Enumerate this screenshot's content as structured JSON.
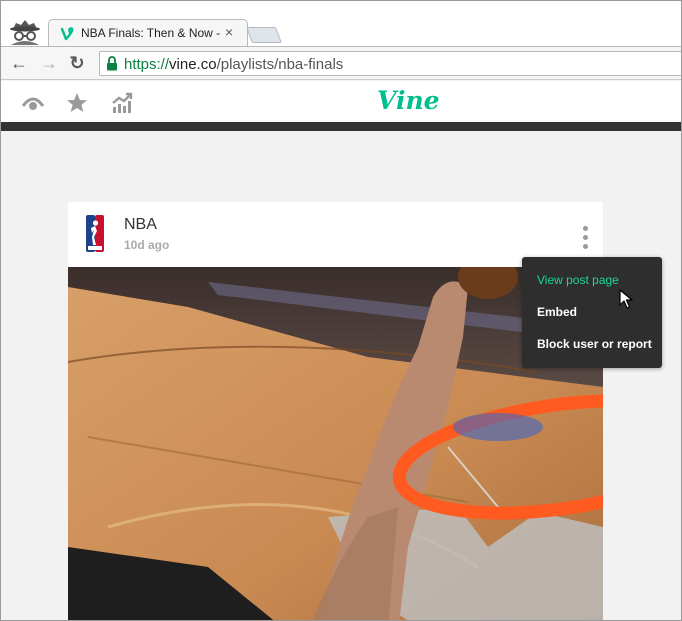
{
  "browser": {
    "tab_title": "NBA Finals: Then & Now -",
    "tab_close": "×",
    "url_scheme": "https://",
    "url_host": "vine.co",
    "url_path": "/playlists/nba-finals",
    "nav": {
      "back": "←",
      "forward": "→",
      "reload": "↻"
    }
  },
  "vine_header": {
    "logo": "Vine",
    "icons": [
      "eye-icon",
      "star-icon",
      "trending-icon"
    ]
  },
  "post": {
    "author": "NBA",
    "time_ago": "10d ago"
  },
  "menu": {
    "items": [
      {
        "label": "View post page",
        "active": true
      },
      {
        "label": "Embed",
        "active": false
      },
      {
        "label": "Block user or report",
        "active": false
      }
    ]
  },
  "colors": {
    "vine_green": "#00bf8f",
    "menu_bg": "#2e2e2e",
    "menu_active": "#1bd69e",
    "secure_green": "#0b8043"
  }
}
